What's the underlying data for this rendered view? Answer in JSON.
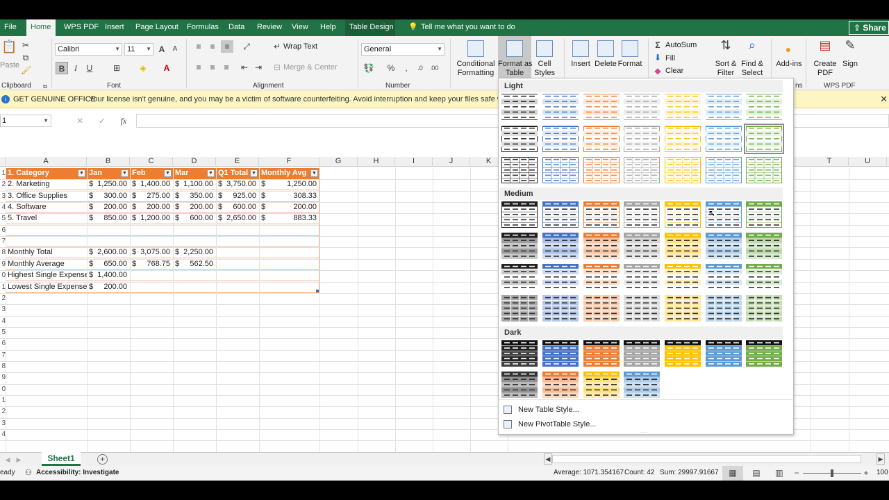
{
  "tabs": [
    {
      "label": "File"
    },
    {
      "label": "Home"
    },
    {
      "label": "WPS PDF"
    },
    {
      "label": "Insert"
    },
    {
      "label": "Page Layout"
    },
    {
      "label": "Formulas"
    },
    {
      "label": "Data"
    },
    {
      "label": "Review"
    },
    {
      "label": "View"
    },
    {
      "label": "Help"
    },
    {
      "label": "Table Design"
    }
  ],
  "tell_me": "Tell me what you want to do",
  "share": "Share",
  "ribbon": {
    "clipboard": {
      "paste": "Paste",
      "label": "Clipboard"
    },
    "font": {
      "name": "Calibri",
      "size": "11",
      "bold": "B",
      "italic": "I",
      "underline": "U",
      "label": "Font"
    },
    "alignment": {
      "wrap": "Wrap Text",
      "merge": "Merge & Center",
      "label": "Alignment"
    },
    "number": {
      "format": "General",
      "percent": "%",
      "comma": ",",
      "label": "Number"
    },
    "styles": {
      "conditional": "Conditional",
      "conditional2": "Formatting",
      "format_table": "Format as",
      "format_table2": "Table",
      "cell_styles": "Cell",
      "cell_styles2": "Styles"
    },
    "cells": {
      "insert": "Insert",
      "delete": "Delete",
      "format": "Format"
    },
    "editing": {
      "autosum": "AutoSum",
      "fill": "Fill",
      "clear": "Clear",
      "sort": "Sort &",
      "sort2": "Filter",
      "find": "Find &",
      "find2": "Select"
    },
    "addins": {
      "label": "Add-ins",
      "group": "ns"
    },
    "wps": {
      "create": "Create",
      "create2": "PDF",
      "sign": "Sign",
      "label": "WPS PDF"
    }
  },
  "warning": {
    "title": "GET GENUINE OFFICE",
    "message": "Your license isn't genuine, and you may be a victim of software counterfeiting. Avoid interruption and keep your files safe with genu",
    "close": "✕"
  },
  "formula_bar": {
    "name_box": "1",
    "fx": "fx"
  },
  "columns": [
    "A",
    "B",
    "C",
    "D",
    "E",
    "F",
    "G",
    "H",
    "I",
    "J",
    "K",
    "T",
    "U"
  ],
  "rows": [
    "1",
    "2",
    "3",
    "4",
    "5",
    "6",
    "7",
    "8",
    "9",
    "0",
    "1",
    "2",
    "3",
    "4",
    "5",
    "6",
    "7",
    "8",
    "9",
    "0",
    "1",
    "2",
    "3",
    "4"
  ],
  "table_header": [
    "1. Category",
    "Jan",
    "Feb",
    "Mar",
    "Q1 Total",
    "Monthly Avg"
  ],
  "table_rows": [
    [
      "2. Marketing",
      "$1,250.00",
      "$1,400.00",
      "$1,100.00",
      "$3,750.00",
      "$",
      "1,250.00"
    ],
    [
      "3. Office Supplies",
      "$   300.00",
      "$   275.00",
      "$   350.00",
      "$   925.00",
      "$",
      "308.33"
    ],
    [
      "4. Software",
      "$   200.00",
      "$   200.00",
      "$   200.00",
      "$   600.00",
      "$",
      "200.00"
    ],
    [
      "5. Travel",
      "$   850.00",
      "$1,200.00",
      "$   600.00",
      "$2,650.00",
      "$",
      "883.33"
    ]
  ],
  "summary_rows": [
    [
      "Monthly Total",
      "$2,600.00",
      "$3,075.00",
      "$2,250.00"
    ],
    [
      "Monthly Average",
      "$   650.00",
      "$   768.75",
      "$   562.50"
    ],
    [
      "Highest Single Expense",
      "$1,400.00",
      "",
      ""
    ],
    [
      "Lowest Single Expense",
      "$   200.00",
      "",
      ""
    ]
  ],
  "gallery": {
    "light": "Light",
    "medium": "Medium",
    "dark": "Dark",
    "new_table_style": "New Table Style...",
    "new_pivot_style": "New PivotTable Style...",
    "palette": [
      "#222222",
      "#4472c4",
      "#ed7d31",
      "#a5a5a5",
      "#ffc000",
      "#5b9bd5",
      "#70ad47"
    ]
  },
  "sheet": {
    "name": "Sheet1",
    "add": "+"
  },
  "status": {
    "ready": "eady",
    "accessibility": "Accessibility: Investigate",
    "average": "Average: 1071.354167",
    "count": "Count: 42",
    "sum": "Sum: 29997.91667",
    "zoom": "100"
  }
}
